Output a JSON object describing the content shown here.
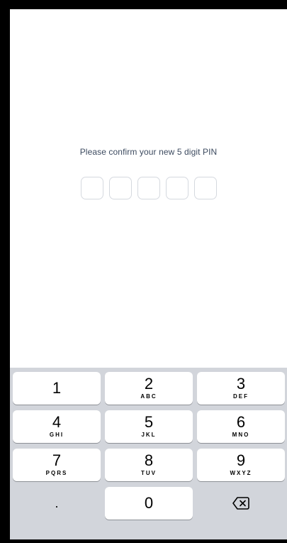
{
  "pin": {
    "prompt": "Please confirm your new 5 digit PIN",
    "length": 5
  },
  "keypad": {
    "rows": [
      [
        {
          "digit": "1",
          "letters": ""
        },
        {
          "digit": "2",
          "letters": "ABC"
        },
        {
          "digit": "3",
          "letters": "DEF"
        }
      ],
      [
        {
          "digit": "4",
          "letters": "GHI"
        },
        {
          "digit": "5",
          "letters": "JKL"
        },
        {
          "digit": "6",
          "letters": "MNO"
        }
      ],
      [
        {
          "digit": "7",
          "letters": "PQRS"
        },
        {
          "digit": "8",
          "letters": "TUV"
        },
        {
          "digit": "9",
          "letters": "WXYZ"
        }
      ]
    ],
    "bottom": {
      "dot": ".",
      "zero": "0",
      "backspace_icon": "backspace-icon"
    }
  },
  "colors": {
    "keyboard_bg": "#d2d5db",
    "key_bg": "#ffffff",
    "prompt_text": "#3c4a5f",
    "pin_box_border": "#d5d9df"
  }
}
